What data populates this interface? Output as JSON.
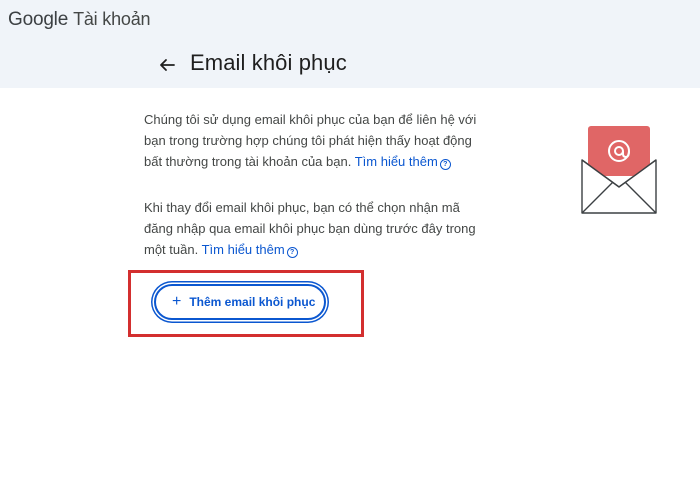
{
  "header": {
    "brand_google": "Google",
    "brand_account": "Tài khoản"
  },
  "page": {
    "title": "Email khôi phục",
    "paragraph1_text": "Chúng tôi sử dụng email khôi phục của bạn để liên hệ với bạn trong trường hợp chúng tôi phát hiện thấy hoạt động bất thường trong tài khoản của bạn.",
    "paragraph1_link": "Tìm hiểu thêm",
    "paragraph2_text": "Khi thay đổi email khôi phục, bạn có thể chọn nhận mã đăng nhập qua email khôi phục bạn dùng trước đây trong một tuần.",
    "paragraph2_link": "Tìm hiểu thêm",
    "add_button_label": "Thêm email khôi phục",
    "add_button_icon": "+",
    "help_icon": "?"
  },
  "colors": {
    "accent": "#0b57d0",
    "header_bg": "#f0f4f9",
    "highlight": "#d32f2f",
    "envelope_red": "#e06666"
  },
  "icons": [
    "back-arrow-icon",
    "help-icon",
    "plus-icon",
    "envelope-email-icon"
  ]
}
